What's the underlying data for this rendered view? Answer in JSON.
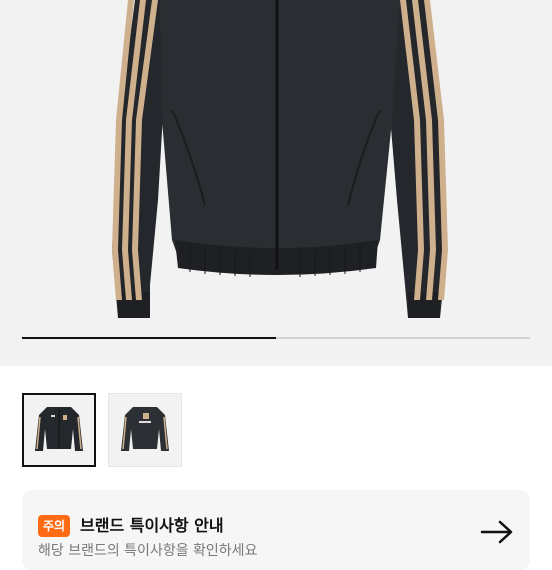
{
  "gallery": {
    "main_image_icon": "jacket-image",
    "progress_fraction": 0.5,
    "thumbnails": [
      {
        "icon": "jacket-front-thumbnail",
        "selected": true
      },
      {
        "icon": "jacket-back-thumbnail",
        "selected": false
      }
    ]
  },
  "notice": {
    "badge": "주의",
    "title": "브랜드 특이사항 안내",
    "subtitle": "해당 브랜드의 특이사항을 확인하세요",
    "arrow_icon": "arrow-right-icon"
  },
  "colors": {
    "accent": "#ff6a14",
    "background": "#f2f2f2",
    "jacket": "#24272b",
    "stripe": "#cfb08c"
  }
}
